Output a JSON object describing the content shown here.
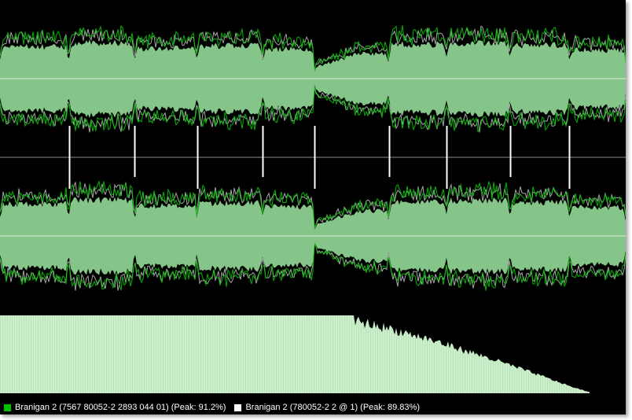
{
  "colors": {
    "background": "#000000",
    "track_a": "#00c000",
    "track_b": "#ffffff",
    "overlay_fill": "#86c58a",
    "alt_outline": "#b8b8b8",
    "spectrum_a": "#c9f0c9",
    "spectrum_b": "#d6d6d6",
    "axis_line": "#8a8a8a",
    "marker": "#ffffff"
  },
  "legend": [
    {
      "name": "track-a",
      "swatch": "green",
      "label": "Branigan 2 (7567 80052-2 2893 044 01) (Peak: 91.2%)"
    },
    {
      "name": "track-b",
      "swatch": "white",
      "label": "Branigan 2 (780052-2 2 @ 1) (Peak: 89.83%)"
    }
  ],
  "track_markers": [
    0.11,
    0.215,
    0.315,
    0.42,
    0.502,
    0.622,
    0.713,
    0.815,
    0.91
  ],
  "track_levels": [
    0.78,
    0.88,
    0.74,
    0.8,
    0.72,
    0.62,
    0.84,
    0.86,
    0.82,
    0.7,
    0.9
  ]
}
